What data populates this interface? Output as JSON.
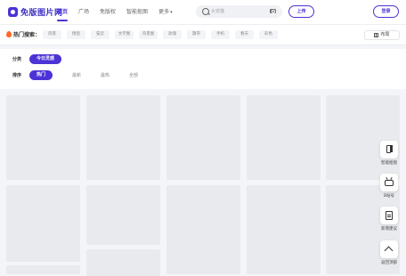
{
  "header": {
    "logo_text": "免版图片网",
    "nav": [
      {
        "label": "首页",
        "active": true
      },
      {
        "label": "广场",
        "active": false
      },
      {
        "label": "免版权",
        "active": false
      },
      {
        "label": "智能抠图",
        "active": false
      },
      {
        "label": "更多",
        "active": false
      }
    ],
    "search_placeholder": "女孩猫",
    "upload_label": "上传",
    "login_label": "登录"
  },
  "hot_search": {
    "label": "热门搜索：",
    "chips": [
      "风景",
      "情侣",
      "猫云",
      "文字图",
      "背景图",
      "玫瑰",
      "飘带",
      "手机",
      "春天",
      "彩色"
    ],
    "layout_label": "布局"
  },
  "filters": {
    "category_label": "分类",
    "category_value": "今日灵感",
    "sort_label": "排序",
    "sort_options": [
      {
        "label": "热门",
        "active": true
      },
      {
        "label": "最新",
        "active": false
      },
      {
        "label": "最热",
        "active": false
      },
      {
        "label": "全部",
        "active": false
      }
    ]
  },
  "floating_tools": [
    {
      "label": "智能抠图",
      "icon": "phone-icon"
    },
    {
      "label": "B站号",
      "icon": "bilibili-icon"
    },
    {
      "label": "新增建议",
      "icon": "feedback-icon"
    },
    {
      "label": "返回顶部",
      "icon": "back-to-top-icon"
    }
  ],
  "colors": {
    "accent": "#4b33d6",
    "placeholder_tile": "#e9eaee",
    "page_bg": "#f4f5f8"
  }
}
